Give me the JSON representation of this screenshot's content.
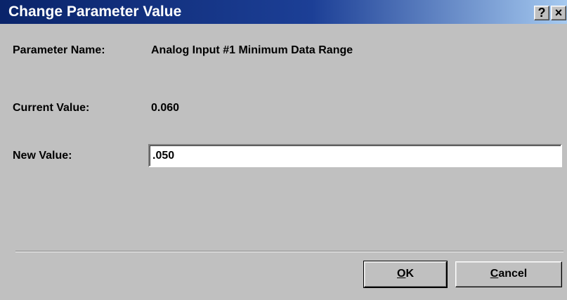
{
  "window": {
    "title": "Change Parameter Value",
    "help_button": "?",
    "close_button": "×"
  },
  "form": {
    "parameter_name_label": "Parameter Name:",
    "parameter_name_value": "Analog Input #1 Minimum Data Range",
    "current_value_label": "Current Value:",
    "current_value": "0.060",
    "new_value_label": "New Value:",
    "new_value": ".050"
  },
  "buttons": {
    "ok_mnemonic": "O",
    "ok_rest": "K",
    "cancel_mnemonic": "C",
    "cancel_rest": "ancel"
  },
  "colors": {
    "title_bar_start": "#0a246a",
    "title_bar_end": "#a6caf0",
    "dialog_background": "#c0c0c0"
  }
}
